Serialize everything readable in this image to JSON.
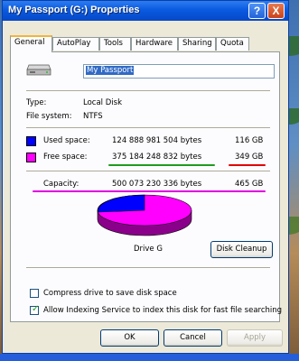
{
  "window": {
    "title": "My Passport (G:) Properties",
    "help_label": "?",
    "close_label": "X"
  },
  "tabs": [
    {
      "label": "General",
      "active": true
    },
    {
      "label": "AutoPlay"
    },
    {
      "label": "Tools"
    },
    {
      "label": "Hardware"
    },
    {
      "label": "Sharing"
    },
    {
      "label": "Quota"
    }
  ],
  "drive": {
    "icon": "drive-icon",
    "name_value": "My Passport",
    "type_label": "Type:",
    "type_value": "Local Disk",
    "fs_label": "File system:",
    "fs_value": "NTFS"
  },
  "space": {
    "used_label": "Used space:",
    "used_bytes": "124 888 981 504 bytes",
    "used_gb": "116 GB",
    "used_color": "#0000ff",
    "free_label": "Free space:",
    "free_bytes": "375 184 248 832 bytes",
    "free_gb": "349 GB",
    "free_color": "#ff00ff",
    "capacity_label": "Capacity:",
    "capacity_bytes": "500 073 230 336 bytes",
    "capacity_gb": "465 GB",
    "drive_label": "Drive G",
    "disk_cleanup": "Disk Cleanup"
  },
  "annotation_colors": {
    "green": "#1f9a1f",
    "red": "#e00000",
    "magenta": "#e000e0"
  },
  "options": {
    "compress_label": "Compress drive to save disk space",
    "compress_checked": false,
    "index_label": "Allow Indexing Service to index this disk for fast file searching",
    "index_checked": true
  },
  "buttons": {
    "ok": "OK",
    "cancel": "Cancel",
    "apply": "Apply"
  }
}
